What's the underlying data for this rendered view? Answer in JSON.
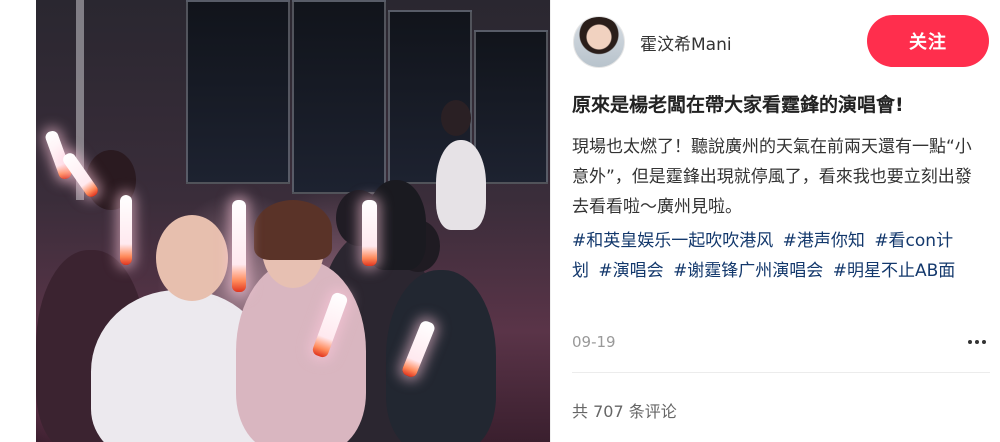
{
  "author": {
    "name": "霍汶希Mani",
    "follow_label": "关注"
  },
  "post": {
    "title": "原來是楊老闆在帶大家看霆鋒的演唱會!",
    "body": "現場也太燃了！聽說廣州的天氣在前兩天還有一點“小意外”，但是霆鋒出現就停風了，看來我也要立刻出發去看看啦～廣州見啦。",
    "tags": [
      "#和英皇娱乐一起吹吹港风",
      "#港声你知",
      "#看con计划",
      "#演唱会",
      "#谢霆锋广州演唱会",
      "#明星不止AB面"
    ],
    "date": "09-19",
    "comment_count": "共 707 条评论"
  },
  "colors": {
    "follow_button": "#ff2e4d",
    "tag_link": "#13386c",
    "muted_text": "#999999"
  },
  "icons": {
    "more": "more-dots-icon",
    "avatar": "avatar"
  }
}
